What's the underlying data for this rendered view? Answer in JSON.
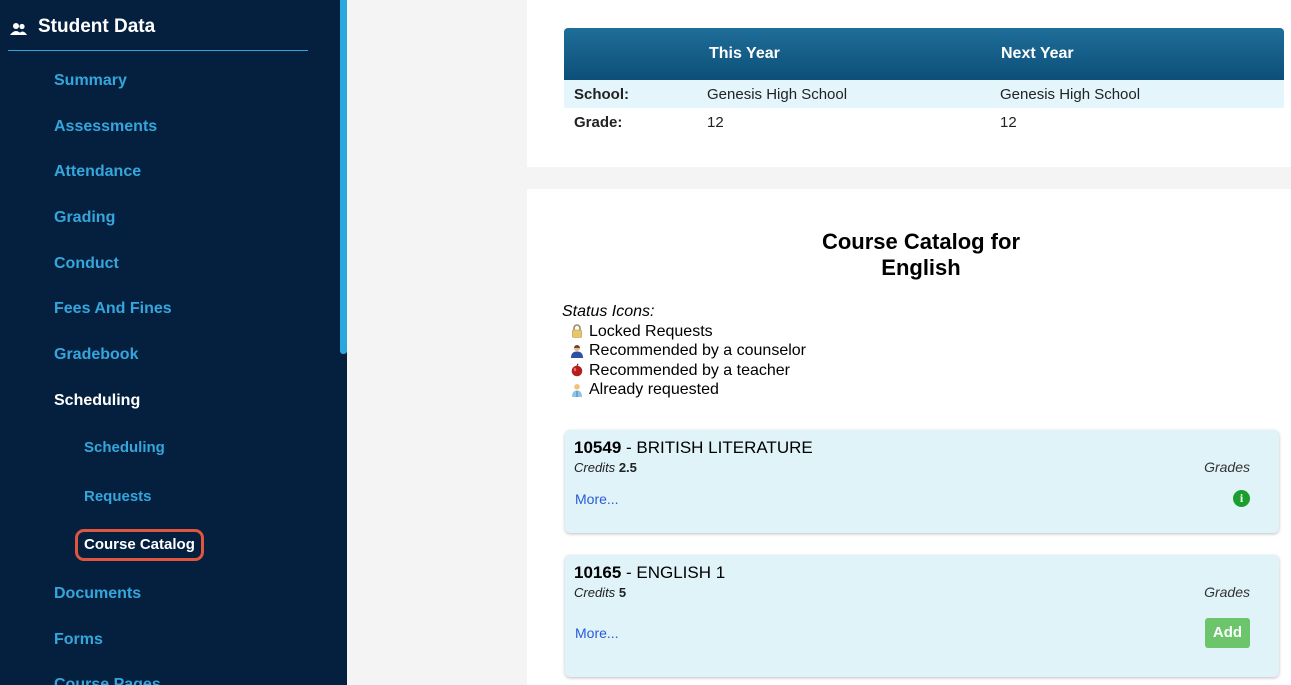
{
  "sidebar": {
    "header": "Student Data",
    "items": [
      {
        "label": "Summary"
      },
      {
        "label": "Assessments"
      },
      {
        "label": "Attendance"
      },
      {
        "label": "Grading"
      },
      {
        "label": "Conduct"
      },
      {
        "label": "Fees And Fines"
      },
      {
        "label": "Gradebook"
      },
      {
        "label": "Scheduling"
      },
      {
        "label": "Documents"
      },
      {
        "label": "Forms"
      },
      {
        "label": "Course Pages"
      }
    ],
    "sub_items": [
      {
        "label": "Scheduling"
      },
      {
        "label": "Requests"
      },
      {
        "label": "Course Catalog"
      }
    ]
  },
  "info_table": {
    "headers": [
      "This Year",
      "Next Year"
    ],
    "rows": [
      {
        "label": "School:",
        "this_year": "Genesis High School",
        "next_year": "Genesis High School"
      },
      {
        "label": "Grade:",
        "this_year": "12",
        "next_year": "12"
      }
    ]
  },
  "catalog": {
    "title_line1": "Course Catalog for",
    "title_line2": "English",
    "status_title": "Status Icons:",
    "status_items": [
      {
        "label": "Locked Requests",
        "icon": "lock-icon"
      },
      {
        "label": "Recommended by a counselor",
        "icon": "counselor-icon"
      },
      {
        "label": "Recommended by a teacher",
        "icon": "apple-icon"
      },
      {
        "label": "Already requested",
        "icon": "requested-icon"
      }
    ],
    "courses": [
      {
        "code": "10549",
        "name": " - BRITISH LITERATURE",
        "credits_label": "Credits",
        "credits": "2.5",
        "grades_label": "Grades",
        "more": "More...",
        "action": "info"
      },
      {
        "code": "10165",
        "name": " - ENGLISH 1",
        "credits_label": "Credits",
        "credits": "5",
        "grades_label": "Grades",
        "more": "More...",
        "action_label": "Add"
      }
    ]
  },
  "colors": {
    "sidebar_bg": "#05203f",
    "sidebar_link": "#35a6dc",
    "header_bar": "#0c4f78",
    "course_bg": "#dff3f8",
    "add_button": "#6cc56a",
    "highlight_border": "#e0553e"
  }
}
